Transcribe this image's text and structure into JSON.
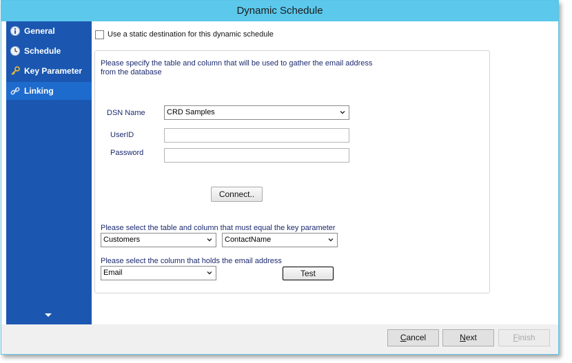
{
  "window": {
    "title": "Dynamic Schedule"
  },
  "sidebar": {
    "items": [
      {
        "label": "General",
        "icon": "info-icon"
      },
      {
        "label": "Schedule",
        "icon": "clock-icon"
      },
      {
        "label": "Key Parameter",
        "icon": "key-icon"
      },
      {
        "label": "Linking",
        "icon": "link-icon",
        "active": true
      }
    ]
  },
  "static_destination": {
    "label": "Use a static destination for this dynamic schedule",
    "checked": false
  },
  "instructions": {
    "line1": "Please specify the table and column that will be used to gather the email address",
    "line2": "from the database"
  },
  "dsn": {
    "label": "DSN Name",
    "value": "CRD Samples"
  },
  "userid": {
    "label": "UserID",
    "value": ""
  },
  "password": {
    "label": "Password",
    "value": ""
  },
  "connect_label": "Connect..",
  "key_param": {
    "label": "Please select the table and column that must equal the key parameter",
    "table": "Customers",
    "column": "ContactName"
  },
  "email_col": {
    "label": "Please select the column that holds the email address",
    "value": "Email",
    "test_label": "Test"
  },
  "footer": {
    "cancel_prefix": "C",
    "cancel_rest": "ancel",
    "next_prefix": "N",
    "next_rest": "ext",
    "finish_prefix": "F",
    "finish_rest": "inish"
  },
  "colors": {
    "titlebar": "#5bc8ec",
    "sidebar": "#1b57b0",
    "sidebar_active": "#1e6bce",
    "instruction_text": "#1c2a6e"
  }
}
